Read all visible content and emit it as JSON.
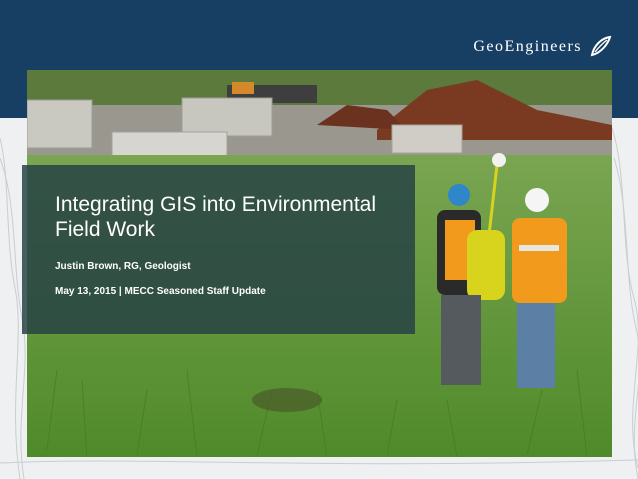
{
  "header": {
    "logo_text": "GeoEngineers",
    "logo_icon": "leaf-swoosh-icon",
    "background_color": "#173f63"
  },
  "slide": {
    "title": "Integrating GIS into Environmental Field Work",
    "author": "Justin Brown, RG, Geologist",
    "date_event": "May 13, 2015 | MECC Seasoned Staff Update",
    "photo": "two-field-workers-with-gps-in-grass"
  },
  "colors": {
    "overlay": "#264244",
    "grass": "#5f9a35",
    "safety_vest": "#f29a1c"
  }
}
